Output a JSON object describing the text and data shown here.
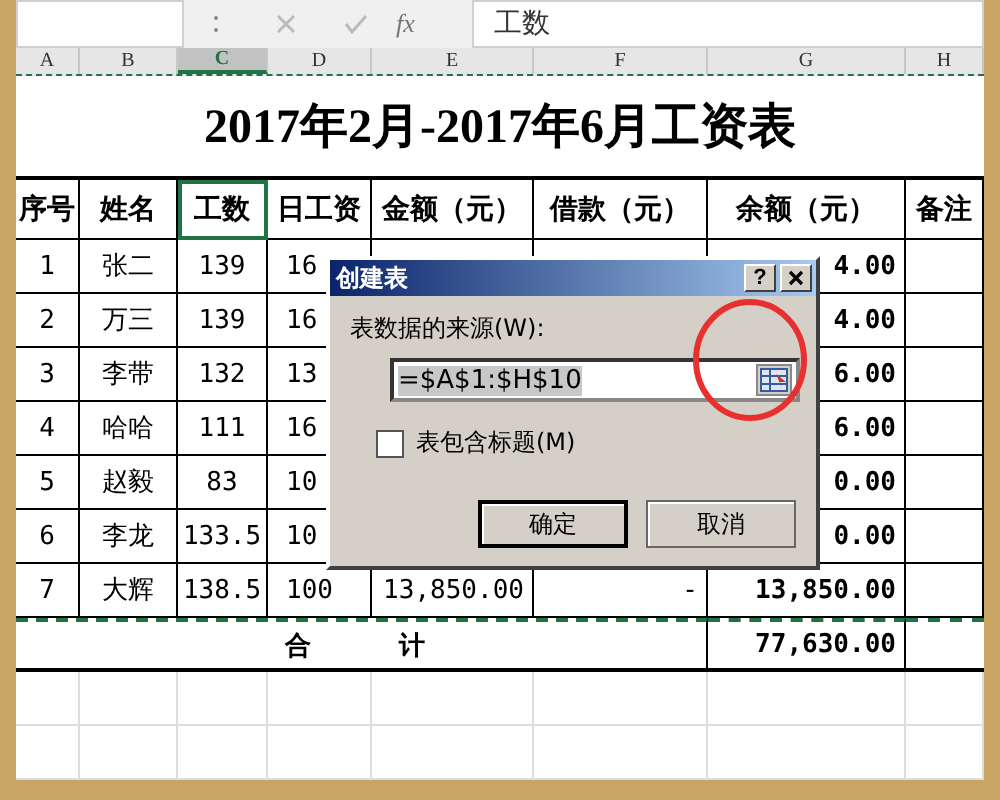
{
  "formula_bar": {
    "fx": "fx",
    "value": "工数"
  },
  "columns": [
    {
      "label": "A",
      "selected": false
    },
    {
      "label": "B",
      "selected": false
    },
    {
      "label": "C",
      "selected": true
    },
    {
      "label": "D",
      "selected": false
    },
    {
      "label": "E",
      "selected": false
    },
    {
      "label": "F",
      "selected": false
    },
    {
      "label": "G",
      "selected": false
    },
    {
      "label": "H",
      "selected": false
    }
  ],
  "title": "2017年2月-2017年6月工资表",
  "headers": [
    "序号",
    "姓名",
    "工数",
    "日工资",
    "金额（元）",
    "借款（元）",
    "余额（元）",
    "备注"
  ],
  "rows": [
    {
      "cells": [
        "1",
        "张二",
        "139",
        "16",
        null,
        null,
        "4.00",
        null
      ]
    },
    {
      "cells": [
        "2",
        "万三",
        "139",
        "16",
        null,
        null,
        "4.00",
        null
      ]
    },
    {
      "cells": [
        "3",
        "李带",
        "132",
        "13",
        null,
        null,
        "6.00",
        null
      ]
    },
    {
      "cells": [
        "4",
        "哈哈",
        "111",
        "16",
        null,
        null,
        "6.00",
        null
      ]
    },
    {
      "cells": [
        "5",
        "赵毅",
        "83",
        "10",
        null,
        null,
        "0.00",
        null
      ]
    },
    {
      "cells": [
        "6",
        "李龙",
        "133.5",
        "10",
        null,
        null,
        "0.00",
        null
      ]
    },
    {
      "cells": [
        "7",
        "大辉",
        "138.5",
        "100",
        "13,850.00",
        "-",
        "13,850.00",
        null
      ]
    }
  ],
  "total": {
    "label": "合　　计",
    "value": "77,630.00"
  },
  "dialog": {
    "title": "创建表",
    "help": "?",
    "source_label": "表数据的来源(W):",
    "source_value": "=$A$1:$H$10",
    "has_headers": {
      "label": "表包含标题(M)",
      "checked": false
    },
    "buttons": [
      {
        "label": "确定",
        "default": true
      },
      {
        "label": "取消",
        "default": false
      }
    ]
  }
}
